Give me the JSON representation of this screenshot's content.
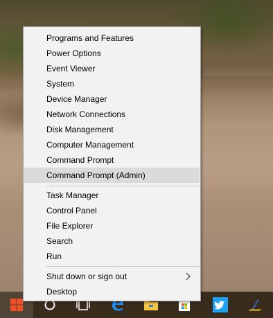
{
  "menu": {
    "items": [
      {
        "label": "Programs and Features"
      },
      {
        "label": "Power Options"
      },
      {
        "label": "Event Viewer"
      },
      {
        "label": "System"
      },
      {
        "label": "Device Manager"
      },
      {
        "label": "Network Connections"
      },
      {
        "label": "Disk Management"
      },
      {
        "label": "Computer Management"
      },
      {
        "label": "Command Prompt"
      },
      {
        "label": "Command Prompt (Admin)",
        "highlighted": true
      },
      {
        "label": "Task Manager"
      },
      {
        "label": "Control Panel"
      },
      {
        "label": "File Explorer"
      },
      {
        "label": "Search"
      },
      {
        "label": "Run"
      },
      {
        "label": "Shut down or sign out",
        "submenu": true
      },
      {
        "label": "Desktop"
      }
    ]
  },
  "taskbar": {
    "icons": [
      {
        "icon": "windows-start-icon",
        "color": "#f25022"
      },
      {
        "icon": "cortana-circle-icon",
        "color": "#ffffff"
      },
      {
        "icon": "task-view-icon",
        "color": "#ffffff"
      },
      {
        "icon": "edge-icon",
        "color": "#1e90ff"
      },
      {
        "icon": "file-explorer-icon",
        "color": "#f4c542"
      },
      {
        "icon": "store-icon",
        "color": "#ffffff"
      },
      {
        "icon": "twitter-icon",
        "color": "#1da1f2"
      },
      {
        "icon": "pen-app-icon",
        "color": "#f0c020"
      }
    ]
  }
}
